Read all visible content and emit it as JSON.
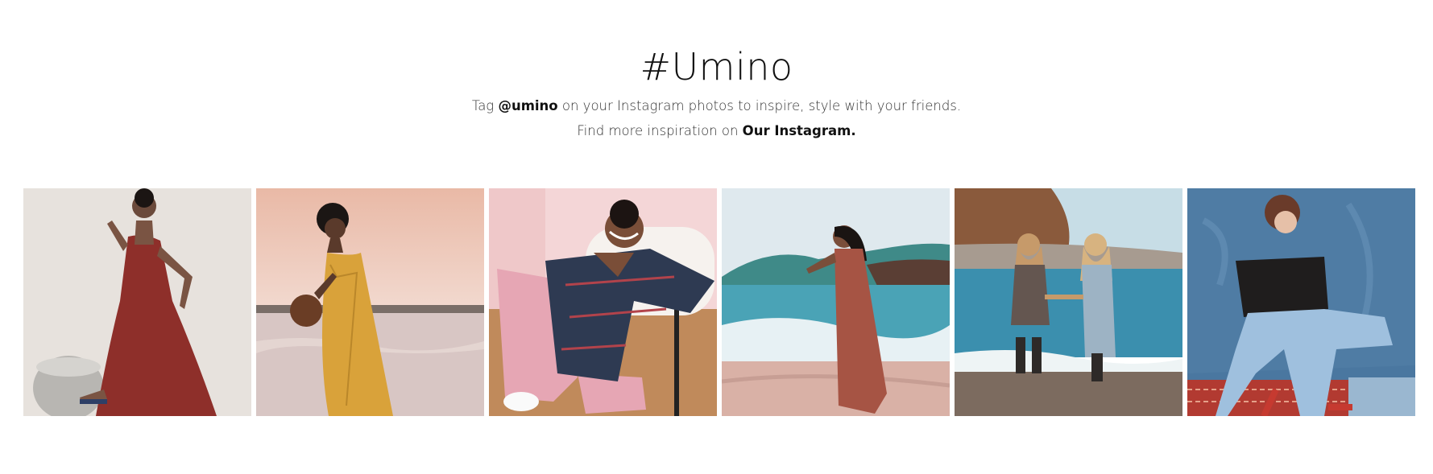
{
  "header": {
    "title": "#Umino",
    "line1_prefix": "Tag ",
    "line1_handle": "@umino",
    "line1_suffix": " on your Instagram photos to inspire, style with your friends.",
    "line2_prefix": "Find more inspiration on ",
    "line2_link": "Our Instagram."
  },
  "gallery": {
    "photos": [
      {
        "subject": "woman in red maxi dress seated on round stool",
        "bg": "#e6e1dc",
        "accent": "#8e2f2a"
      },
      {
        "subject": "woman in yellow plaid dress holding rattan bag at sea",
        "bg": "#e8c8c4",
        "accent": "#d9a23a"
      },
      {
        "subject": "smiling woman in plaid shirt and pink trousers on floor",
        "bg": "#f3d4d6",
        "accent": "#2e3a52"
      },
      {
        "subject": "woman in rust dress walking on beach",
        "bg": "#cfe3ea",
        "accent": "#a65444"
      },
      {
        "subject": "two women holding hands walking toward the sea",
        "bg": "#bfd9e3",
        "accent": "#3b8fae"
      },
      {
        "subject": "woman in black top and light jeans against blue wall",
        "bg": "#4a77a0",
        "accent": "#9fc0de"
      }
    ]
  }
}
